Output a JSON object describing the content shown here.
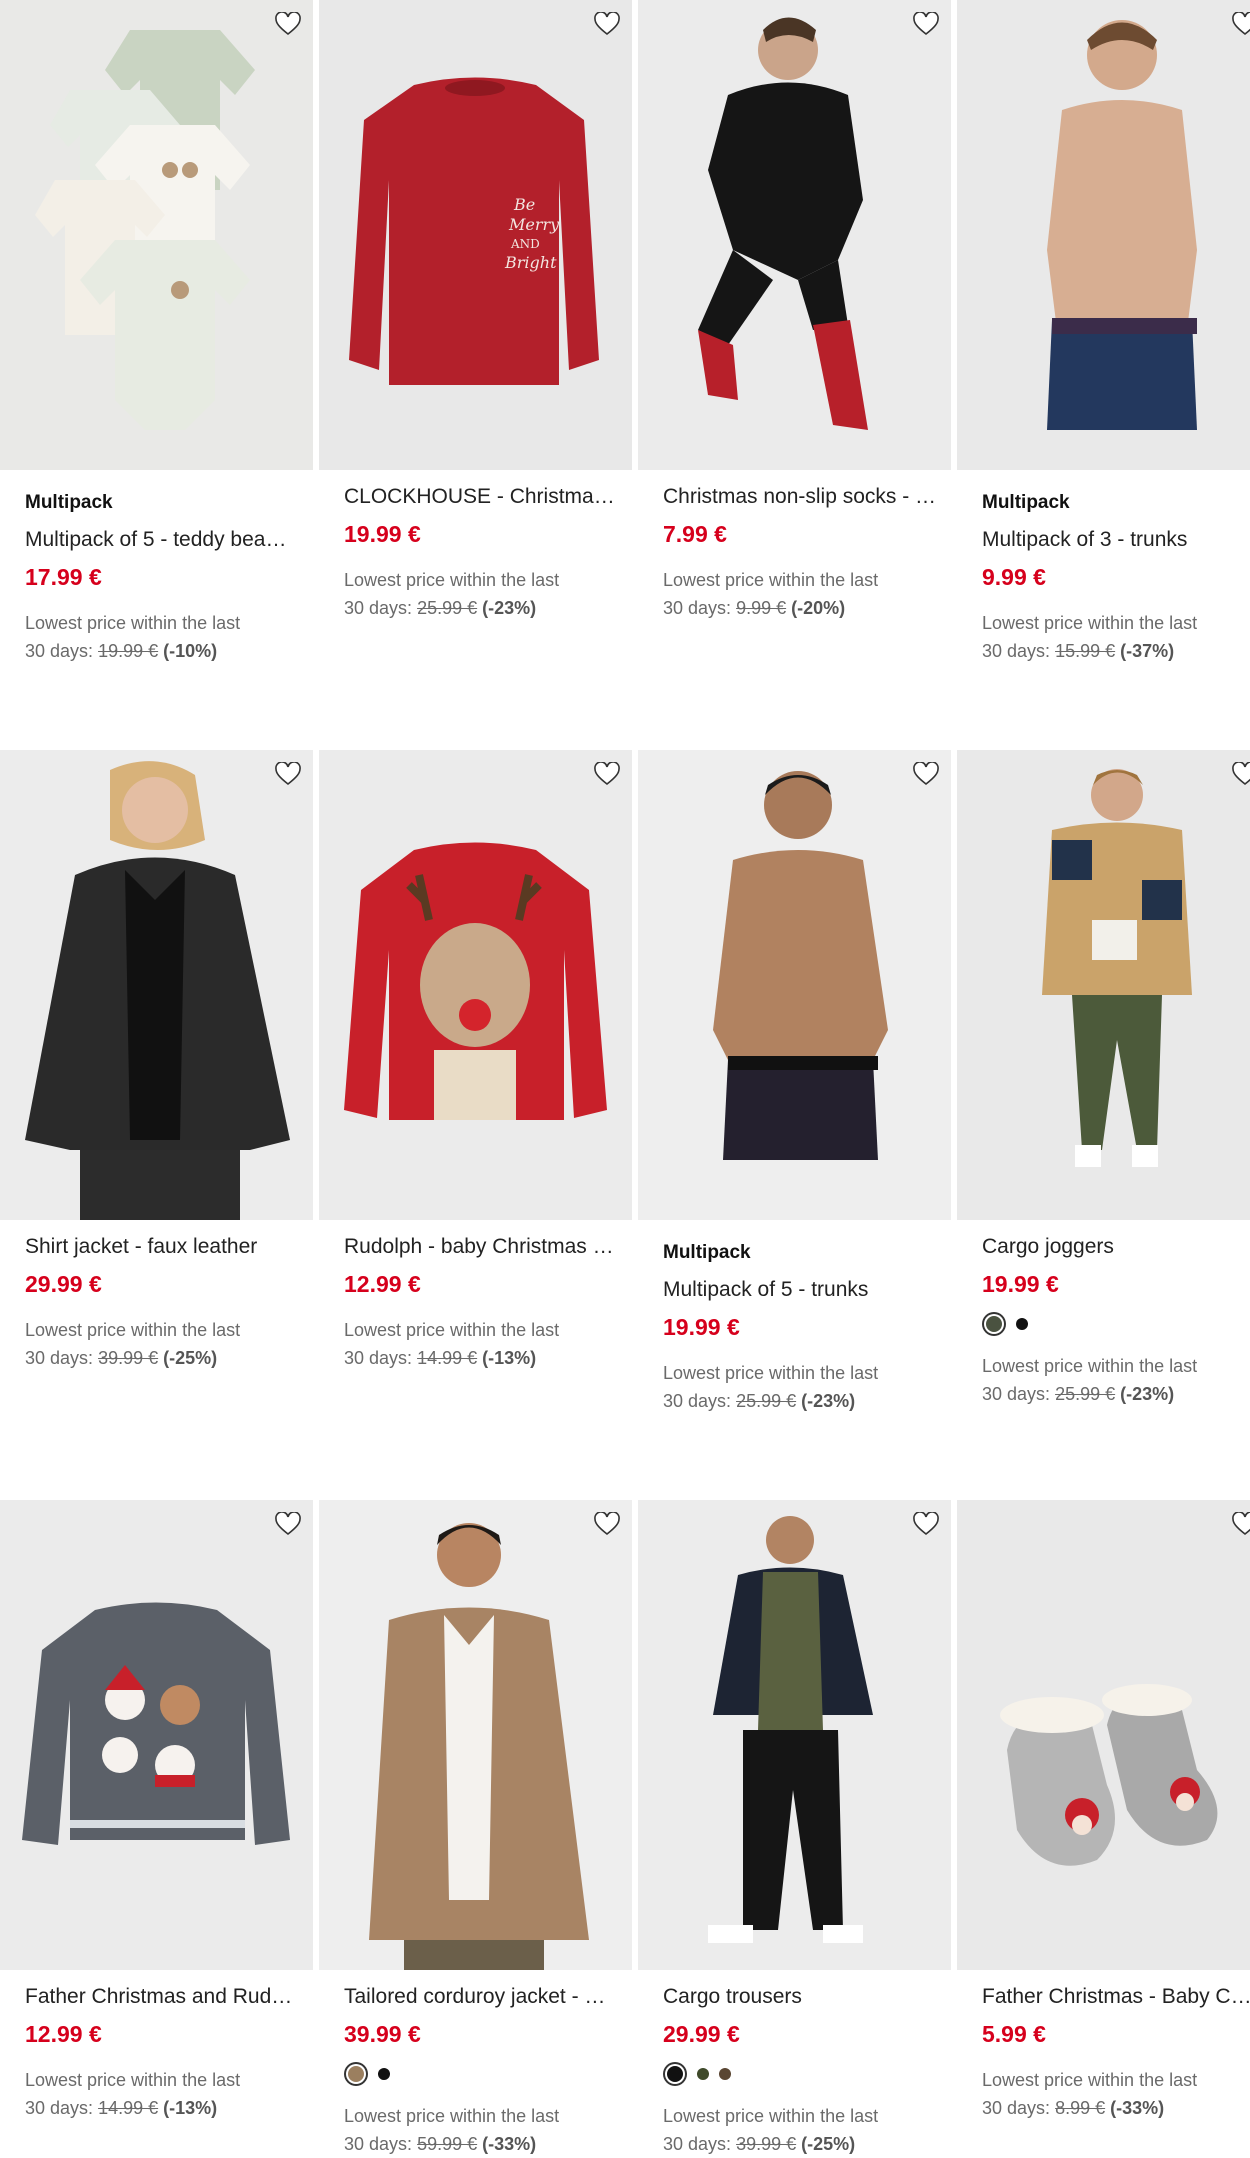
{
  "lowest_label": "Lowest price within the last",
  "days_label": "30 days:",
  "products": [
    {
      "badge": "Multipack",
      "title": "Multipack of 5 - teddy bea…",
      "price": "17.99 €",
      "old_price": "19.99 €",
      "discount": "(-10%)"
    },
    {
      "badge": "",
      "title": "CLOCKHOUSE - Christma…",
      "price": "19.99 €",
      "old_price": "25.99 €",
      "discount": "(-23%)"
    },
    {
      "badge": "",
      "title": "Christmas non-slip socks - …",
      "price": "7.99 €",
      "old_price": "9.99 €",
      "discount": "(-20%)"
    },
    {
      "badge": "Multipack",
      "title": "Multipack of 3 - trunks",
      "price": "9.99 €",
      "old_price": "15.99 €",
      "discount": "(-37%)"
    },
    {
      "badge": "",
      "title": "Shirt jacket - faux leather",
      "price": "29.99 €",
      "old_price": "39.99 €",
      "discount": "(-25%)"
    },
    {
      "badge": "",
      "title": "Rudolph - baby Christmas …",
      "price": "12.99 €",
      "old_price": "14.99 €",
      "discount": "(-13%)"
    },
    {
      "badge": "Multipack",
      "title": "Multipack of 5 - trunks",
      "price": "19.99 €",
      "old_price": "25.99 €",
      "discount": "(-23%)"
    },
    {
      "badge": "",
      "title": "Cargo joggers",
      "price": "19.99 €",
      "old_price": "25.99 €",
      "discount": "(-23%)",
      "swatches": [
        "#4a5240",
        "#111111"
      ]
    },
    {
      "badge": "",
      "title": "Father Christmas and Rud…",
      "price": "12.99 €",
      "old_price": "14.99 €",
      "discount": "(-13%)"
    },
    {
      "badge": "",
      "title": "Tailored corduroy jacket - …",
      "price": "39.99 €",
      "old_price": "59.99 €",
      "discount": "(-33%)",
      "swatches": [
        "#9b7f5f",
        "#111111"
      ]
    },
    {
      "badge": "",
      "title": "Cargo trousers",
      "price": "29.99 €",
      "old_price": "39.99 €",
      "discount": "(-25%)",
      "swatches": [
        "#111111",
        "#3f4a2a",
        "#5a4632"
      ]
    },
    {
      "badge": "",
      "title": "Father Christmas - Baby C…",
      "price": "5.99 €",
      "old_price": "8.99 €",
      "discount": "(-33%)"
    }
  ],
  "images": [
    "teddy-bodysuits-image",
    "red-sweatshirt-image",
    "black-hoodie-socks-image",
    "navy-trunks-image",
    "faux-leather-jacket-image",
    "reindeer-sweater-image",
    "dark-trunks-image",
    "check-shirt-joggers-image",
    "grey-christmas-sweater-image",
    "corduroy-jacket-image",
    "cargo-trousers-image",
    "christmas-slipper-socks-image"
  ],
  "colors": {
    "price": "#d6001c",
    "image_bg": "#ececec"
  }
}
